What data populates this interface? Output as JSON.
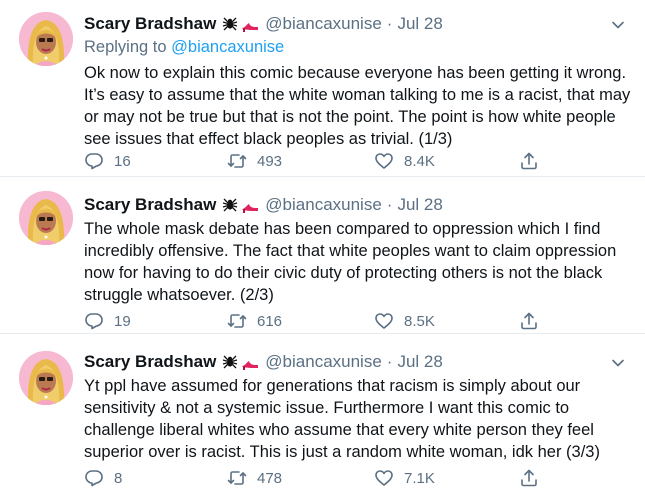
{
  "tweets": [
    {
      "name": "Scary Bradshaw",
      "handle": "@biancaxunise",
      "separator": "·",
      "time": "Jul 28",
      "reply_label": "Replying to",
      "reply_mention": "@biancaxunise",
      "text": "Ok now to explain this comic because everyone has been getting it wrong. It’s easy to assume that the white woman talking to me is a racist, that may or may not be true but that is not the point. The point is how white people see issues that effect black peoples as trivial. (1/3)",
      "replies": "16",
      "retweets": "493",
      "likes": "8.4K"
    },
    {
      "name": "Scary Bradshaw",
      "handle": "@biancaxunise",
      "separator": "·",
      "time": "Jul 28",
      "text": "The whole mask debate has been compared to oppression which I find incredibly offensive. The fact that white peoples want to claim oppression now for having to do their civic duty of protecting others is not the black struggle whatsoever. (2/3)",
      "replies": "19",
      "retweets": "616",
      "likes": "8.5K"
    },
    {
      "name": "Scary Bradshaw",
      "handle": "@biancaxunise",
      "separator": "·",
      "time": "Jul 28",
      "text": "Yt ppl have assumed for generations that racism is simply about our sensitivity & not a systemic issue. Furthermore I want this comic to challenge liberal whites who assume that every white person they feel superior over is racist. This is just a random white woman, idk her (3/3)",
      "replies": "8",
      "retweets": "478",
      "likes": "7.1K"
    }
  ],
  "icons": {
    "name_emoji": [
      "spider-icon",
      "high-heel-icon"
    ],
    "reply": "reply-icon",
    "retweet": "retweet-icon",
    "like": "heart-icon",
    "share": "share-icon",
    "more": "chevron-down-icon"
  },
  "colors": {
    "secondary_text": "#5b7083",
    "link": "#1da1f2",
    "avatar_bg": "#f7b8d2",
    "heel": "#e0245e"
  }
}
